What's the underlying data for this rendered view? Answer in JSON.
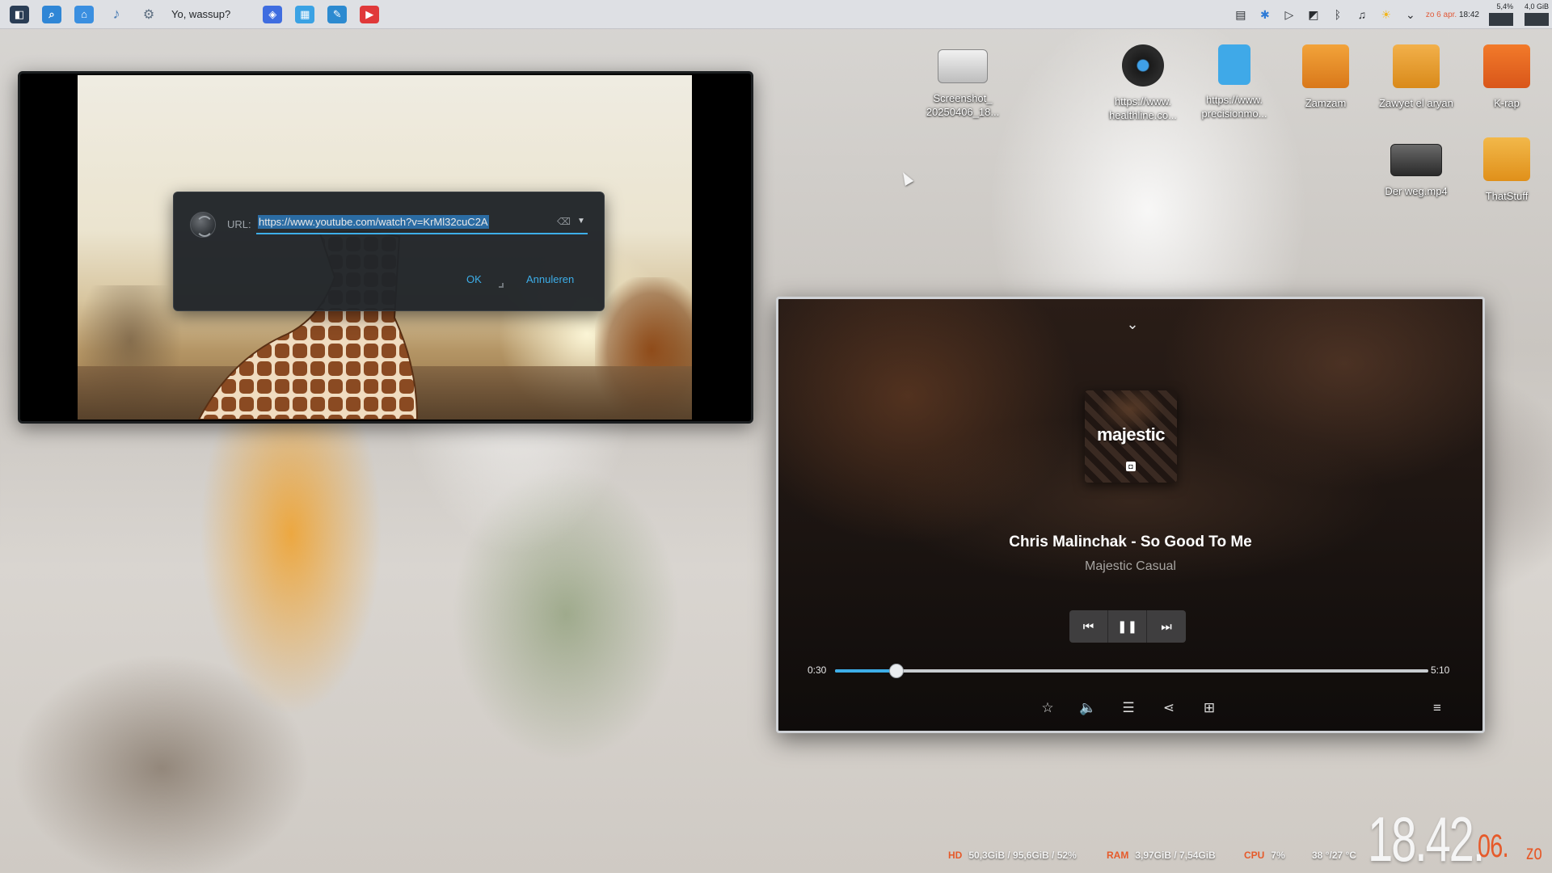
{
  "panel": {
    "launcher_icons": [
      {
        "name": "app-launcher-icon",
        "color": "#2a3d55",
        "glyph": "◧"
      },
      {
        "name": "file-search-icon",
        "color": "#2f86d6",
        "glyph": "⌕"
      },
      {
        "name": "home-folder-icon",
        "color": "#3a8fe0",
        "glyph": "⌂"
      },
      {
        "name": "music-note-icon",
        "color": "#4d7fb5",
        "glyph": "♪"
      },
      {
        "name": "system-settings-icon",
        "color": "#5d6e80",
        "glyph": "⚙"
      }
    ],
    "greeting": "Yo, wassup?",
    "task_icons": [
      {
        "name": "brave-browser-icon",
        "color": "#3f6de0",
        "glyph": "◈"
      },
      {
        "name": "calendar-app-icon",
        "color": "#3aa2e4",
        "glyph": "▦"
      },
      {
        "name": "editor-app-icon",
        "color": "#2c8ad0",
        "glyph": "✎"
      },
      {
        "name": "youtube-player-icon",
        "color": "#e0393a",
        "glyph": "▶"
      }
    ],
    "tray_icons": [
      {
        "name": "notifications-icon",
        "glyph": "▤"
      },
      {
        "name": "network-status-icon",
        "glyph": "✱"
      },
      {
        "name": "media-player-icon",
        "glyph": "▷"
      },
      {
        "name": "clipboard-icon",
        "glyph": "◩"
      },
      {
        "name": "bluetooth-icon",
        "glyph": "ᛒ"
      },
      {
        "name": "volume-icon",
        "glyph": "🔉"
      },
      {
        "name": "weather-icon",
        "glyph": "☀"
      },
      {
        "name": "expand-tray-icon",
        "glyph": "⌄"
      }
    ],
    "clock_date_prefix": "zo 6 apr.",
    "clock_time": "18:42",
    "cpu_mini": "5,4%",
    "mem_mini": "4,0 GiB"
  },
  "video_window": {
    "url_dialog": {
      "label": "URL:",
      "url_value": "https://www.youtube.com/watch?v=KrMl32cuC2A",
      "ok_label": "OK",
      "cancel_label": "Annuleren"
    }
  },
  "desktop_icons": [
    {
      "name": "Screenshot_\n20250406_18...",
      "color": "#d9d9d9"
    },
    {
      "name": "https://www.\nhealthline.co...",
      "color": "#2a2a2a"
    },
    {
      "name": "https://www.\nprecisionmo...",
      "color": "#3fa9e8"
    },
    {
      "name": "Zamzam",
      "color": "#e8891e"
    },
    {
      "name": "Zawyet el aryan",
      "color": "#e69a2a"
    },
    {
      "name": "K-rap",
      "color": "#e56a1e"
    },
    {
      "name": "Der weg.mp4",
      "color": "#3a3a3a"
    },
    {
      "name": "ThatStuff",
      "color": "#e8a02a"
    }
  ],
  "player": {
    "album_brand": "majestic",
    "track_title": "Chris Malinchak - So Good To Me",
    "artist": "Majestic Casual",
    "current_time": "0:30",
    "total_time": "5:10",
    "progress": 0.103
  },
  "stats": {
    "hd_label": "HD",
    "hd_value": "50,3GiB / 95,6GiB / 52%",
    "ram_label": "RAM",
    "ram_value": "3,97GiB / 7,54GiB",
    "cpu_label": "CPU",
    "cpu_value": "7%",
    "temp_value": "38 °/27 °C"
  },
  "big_clock": {
    "hours_minutes": "18.42.",
    "seconds": "06.",
    "day": "zo"
  }
}
